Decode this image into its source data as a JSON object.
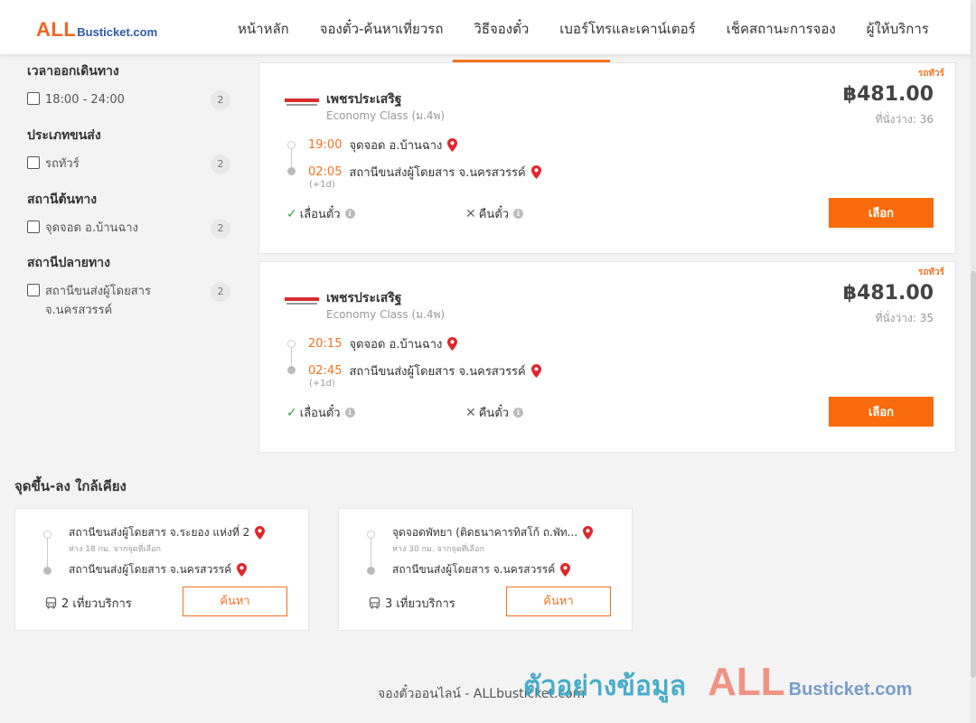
{
  "header": {
    "logo": {
      "all": "ALL",
      "rest": "Busticket.com"
    },
    "nav": [
      "หน้าหลัก",
      "จองตั๋ว-ค้นหาเที่ยวรถ",
      "วิธีจองตั๋ว",
      "เบอร์โทรและเคาน์เตอร์",
      "เช็คสถานะการจอง",
      "ผู้ให้บริการ"
    ]
  },
  "filters": [
    {
      "title": "เวลาออกเดินทาง",
      "option": "18:00 - 24:00",
      "count": "2"
    },
    {
      "title": "ประเภทขนส่ง",
      "option": "รถทัวร์",
      "count": "2"
    },
    {
      "title": "สถานีต้นทาง",
      "option": "จุดจอด อ.บ้านฉาง",
      "count": "2"
    },
    {
      "title": "สถานีปลายทาง",
      "option": "สถานีขนส่งผู้โดยสาร จ.นครสวรรค์",
      "count": "2"
    }
  ],
  "trips": [
    {
      "badge": "รถทัวร์",
      "operator": "เพชรประเสริฐ",
      "class": "Economy Class (ม.4พ)",
      "price": "฿481.00",
      "seats": "ที่นั่งว่าง: 36",
      "depart_time": "19:00",
      "depart_place": "จุดจอด อ.บ้านฉาง",
      "arrive_time": "02:05",
      "arrive_place": "สถานีขนส่งผู้โดยสาร จ.นครสวรรค์",
      "plus_day": "(+1d)",
      "feature_yes": "เลื่อนตั๋ว",
      "feature_no": "คืนตั๋ว",
      "button": "เลือก"
    },
    {
      "badge": "รถทัวร์",
      "operator": "เพชรประเสริฐ",
      "class": "Economy Class (ม.4พ)",
      "price": "฿481.00",
      "seats": "ที่นั่งว่าง: 35",
      "depart_time": "20:15",
      "depart_place": "จุดจอด อ.บ้านฉาง",
      "arrive_time": "02:45",
      "arrive_place": "สถานีขนส่งผู้โดยสาร จ.นครสวรรค์",
      "plus_day": "(+1d)",
      "feature_yes": "เลื่อนตั๋ว",
      "feature_no": "คืนตั๋ว",
      "button": "เลือก"
    }
  ],
  "nearby": {
    "title": "จุดขึ้น-ลง ใกล้เคียง",
    "items": [
      {
        "from": "สถานีขนส่งผู้โดยสาร จ.ระยอง แห่งที่ 2",
        "distance": "ห่าง 18 กม. จากจุดที่เลือก",
        "to": "สถานีขนส่งผู้โดยสาร จ.นครสวรรค์",
        "trips": "2 เที่ยวบริการ",
        "button": "ค้นหา"
      },
      {
        "from": "จุดจอดพัทยา (ติดธนาคารทิสโก้ ถ.พัท...",
        "distance": "ห่าง 30 กม. จากจุดที่เลือก",
        "to": "สถานีขนส่งผู้โดยสาร จ.นครสวรรค์",
        "trips": "3 เที่ยวบริการ",
        "button": "ค้นหา"
      }
    ]
  },
  "footer": {
    "text": "จองตั๋วออนไลน์ - ALLbusticket.com"
  },
  "watermark": {
    "thai": "ตัวอย่างข้อมูล",
    "all": "ALL",
    "rest": "Busticket.com"
  },
  "colors": {
    "accent": "#f96b0c",
    "time": "#f47320",
    "check": "#2e9e3e",
    "pin": "#e0262b"
  },
  "icons": {
    "pin": "map-pin-icon",
    "check": "check-icon",
    "cross": "cross-icon",
    "info": "info-icon",
    "bus": "bus-icon",
    "operator_logo": "operator-logo"
  }
}
